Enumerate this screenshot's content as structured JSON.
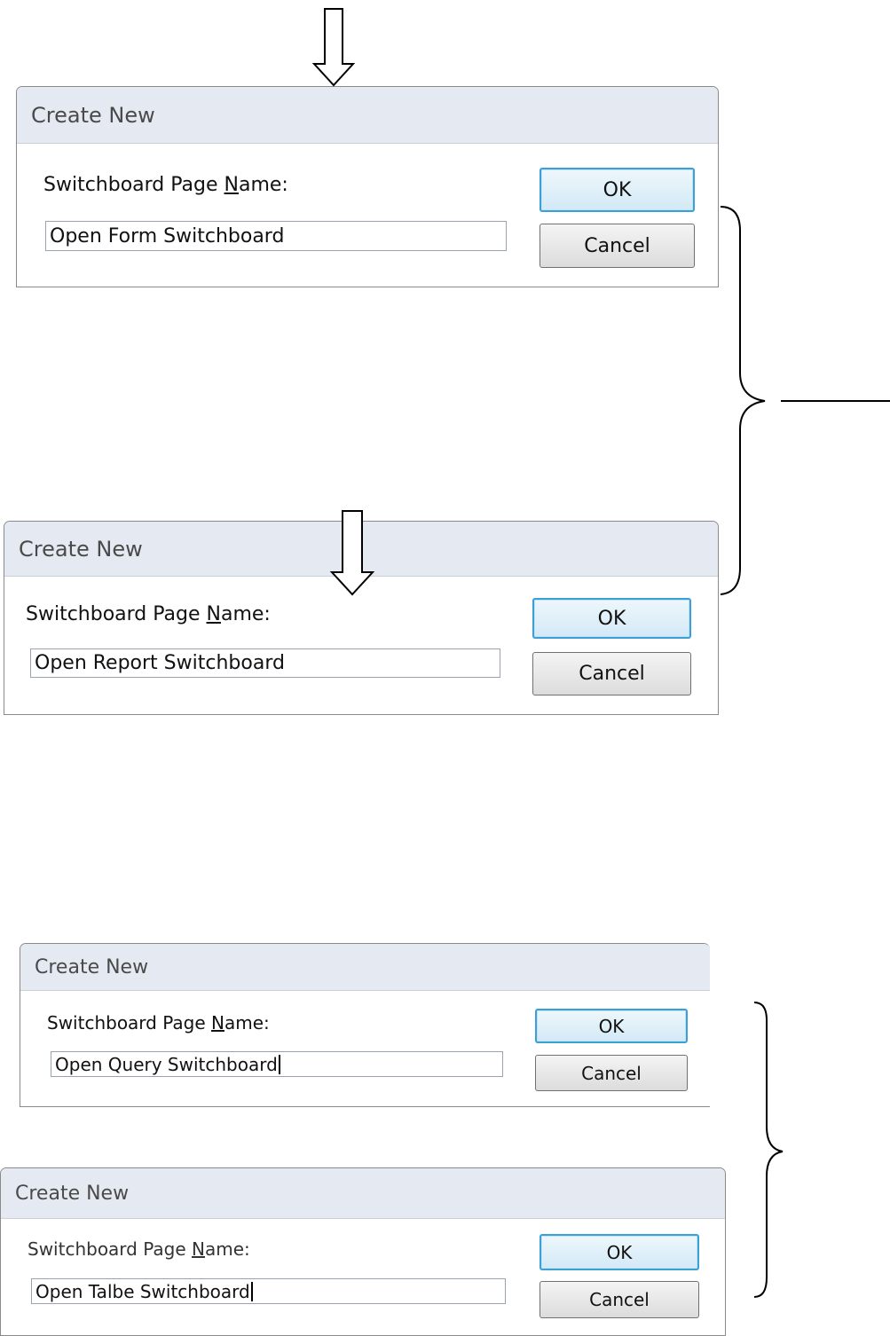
{
  "dialogs": [
    {
      "title": "Create New",
      "label_pre": "Switchboard Page ",
      "label_accel": "N",
      "label_post": "ame:",
      "input_value": "Open Form Switchboard",
      "ok_label": "OK",
      "cancel_label": "Cancel"
    },
    {
      "title": "Create New",
      "label_pre": "Switchboard Page ",
      "label_accel": "N",
      "label_post": "ame:",
      "input_value": "Open Report Switchboard",
      "ok_label": "OK",
      "cancel_label": "Cancel"
    },
    {
      "title": "Create New",
      "label_pre": "Switchboard Page ",
      "label_accel": "N",
      "label_post": "ame:",
      "input_value": "Open Query Switchboard",
      "ok_label": "OK",
      "cancel_label": "Cancel"
    },
    {
      "title": "Create New",
      "label_pre": "Switchboard Page ",
      "label_accel": "N",
      "label_post": "ame:",
      "input_value": "Open Talbe Switchboard",
      "ok_label": "OK",
      "cancel_label": "Cancel"
    }
  ],
  "annotations": {
    "icons": [
      "arrow-down-icon",
      "arrow-down-icon",
      "curly-brace-icon",
      "curly-brace-icon"
    ],
    "stroke_color": "#000000"
  },
  "colors": {
    "titlebar": "#e5eaf2",
    "default_button_border": "#3c9fd6",
    "dialog_border": "#8a8a8a"
  }
}
